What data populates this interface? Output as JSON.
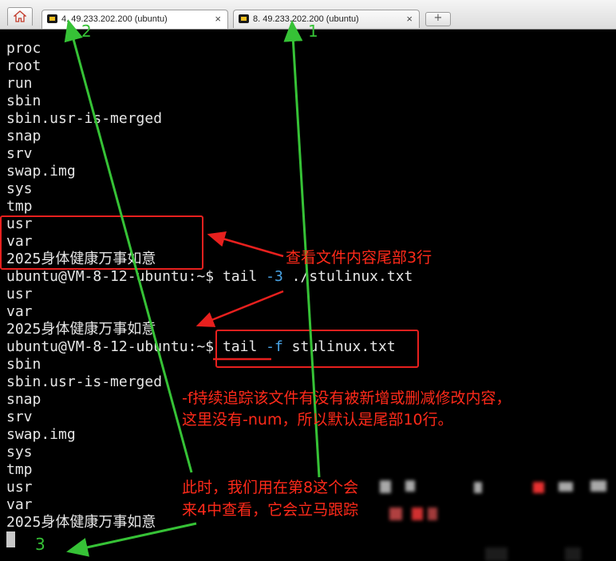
{
  "tabs": [
    {
      "label": "4. 49.233.202.200 (ubuntu)",
      "close": "×",
      "active": true
    },
    {
      "label": "8. 49.233.202.200 (ubuntu)",
      "close": "×",
      "active": false
    }
  ],
  "new_tab_symbol": "+",
  "terminal_lines": [
    {
      "prompt": "",
      "cmd": "",
      "text": "proc"
    },
    {
      "prompt": "",
      "cmd": "",
      "text": "root"
    },
    {
      "prompt": "",
      "cmd": "",
      "text": "run"
    },
    {
      "prompt": "",
      "cmd": "",
      "text": "sbin"
    },
    {
      "prompt": "",
      "cmd": "",
      "text": "sbin.usr-is-merged"
    },
    {
      "prompt": "",
      "cmd": "",
      "text": "snap"
    },
    {
      "prompt": "",
      "cmd": "",
      "text": "srv"
    },
    {
      "prompt": "",
      "cmd": "",
      "text": "swap.img"
    },
    {
      "prompt": "",
      "cmd": "",
      "text": "sys"
    },
    {
      "prompt": "",
      "cmd": "",
      "text": "tmp"
    },
    {
      "prompt": "",
      "cmd": "",
      "text": "usr"
    },
    {
      "prompt": "",
      "cmd": "",
      "text": "var"
    },
    {
      "prompt": "",
      "cmd": "",
      "text": "2025身体健康万事如意"
    },
    {
      "prompt": "ubuntu@VM-8-12-ubuntu:~$ ",
      "cmd": "tail ",
      "flag": "-3",
      "rest": " ./stulinux.txt"
    },
    {
      "prompt": "",
      "cmd": "",
      "text": "usr"
    },
    {
      "prompt": "",
      "cmd": "",
      "text": "var"
    },
    {
      "prompt": "",
      "cmd": "",
      "text": "2025身体健康万事如意"
    },
    {
      "prompt": "ubuntu@VM-8-12-ubuntu:~$ ",
      "cmd": "tail ",
      "flag": "-f",
      "rest": " stulinux.txt"
    },
    {
      "prompt": "",
      "cmd": "",
      "text": "sbin"
    },
    {
      "prompt": "",
      "cmd": "",
      "text": "sbin.usr-is-merged"
    },
    {
      "prompt": "",
      "cmd": "",
      "text": "snap"
    },
    {
      "prompt": "",
      "cmd": "",
      "text": "srv"
    },
    {
      "prompt": "",
      "cmd": "",
      "text": "swap.img"
    },
    {
      "prompt": "",
      "cmd": "",
      "text": "sys"
    },
    {
      "prompt": "",
      "cmd": "",
      "text": "tmp"
    },
    {
      "prompt": "",
      "cmd": "",
      "text": "usr"
    },
    {
      "prompt": "",
      "cmd": "",
      "text": "var"
    },
    {
      "prompt": "",
      "cmd": "",
      "text": "2025身体健康万事如意"
    }
  ],
  "annotations": {
    "note1": "查看文件内容尾部3行",
    "note2_line1": "-f持续追踪该文件有没有被新增或删减修改内容，",
    "note2_line2": "这里没有-num，所以默认是尾部10行。",
    "note3_line1": "此时，我们用在第8这个会",
    "note3_line2": "来4中查看，它会立马跟踪",
    "label1": "1",
    "label2": "2",
    "label3": "3"
  },
  "colors": {
    "terminal_bg": "#000000",
    "terminal_fg": "#e6e6e6",
    "flag_color": "#49a4e6",
    "annotation_red": "#e8201e",
    "arrow_green": "#36c236"
  },
  "icons": [
    "home-icon",
    "terminal-tab-icon",
    "close-icon",
    "new-tab-icon"
  ]
}
